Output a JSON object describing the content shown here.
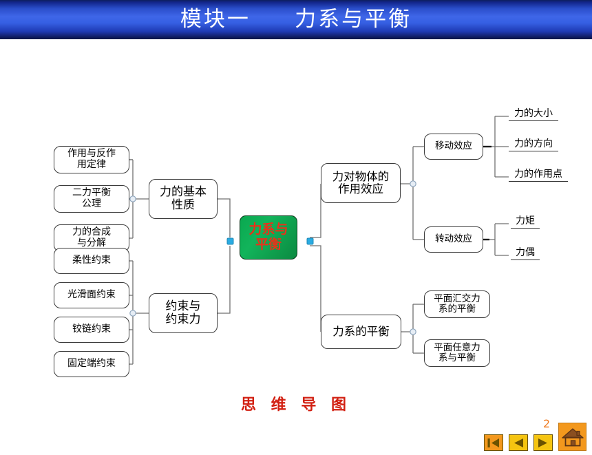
{
  "slide": {
    "title": "模块一     力系与平衡",
    "caption": "思 维 导 图",
    "page_number": "2",
    "colors": {
      "title_bar_blue": "#3f66e8",
      "title_text": "#ffffff",
      "root_green": "#0aa84f",
      "root_text_red": "#e8321a",
      "caption_red": "#d22012",
      "node_border": "#3b3b3b",
      "connector_dot_blue": "#29abe2",
      "connector_dot_gray": "#b8c4cf",
      "nav_orange": "#F3981D",
      "nav_yellow": "#F5C411",
      "page_number_orange": "#f07c22",
      "house_brown": "#8a4f20"
    }
  },
  "mindmap": {
    "root": {
      "label": "力系与\n平衡"
    },
    "branches": [
      {
        "id": "force-basic-properties",
        "label": "力的基本\n性质",
        "side": "left",
        "children": [
          {
            "id": "action-reaction-law",
            "label": "作用与反作\n用定律"
          },
          {
            "id": "two-force-balance-axiom",
            "label": "二力平衡\n公理"
          },
          {
            "id": "force-composition-decomposition",
            "label": "力的合成\n与分解"
          }
        ]
      },
      {
        "id": "constraint-and-constraint-force",
        "label": "约束与\n约束力",
        "side": "left",
        "children": [
          {
            "id": "flexible-constraint",
            "label": "柔性约束"
          },
          {
            "id": "smooth-surface-constraint",
            "label": "光滑面约束"
          },
          {
            "id": "hinge-constraint",
            "label": "铰链约束"
          },
          {
            "id": "fixed-end-constraint",
            "label": "固定端约束"
          }
        ]
      },
      {
        "id": "force-effect-on-object",
        "label": "力对物体的\n作用效应",
        "side": "right",
        "children": [
          {
            "id": "translation-effect",
            "label": "移动效应",
            "children": [
              {
                "id": "force-magnitude",
                "label": "力的大小"
              },
              {
                "id": "force-direction",
                "label": "力的方向"
              },
              {
                "id": "force-application-point",
                "label": "力的作用点"
              }
            ]
          },
          {
            "id": "rotation-effect",
            "label": "转动效应",
            "children": [
              {
                "id": "moment-of-force",
                "label": "力矩"
              },
              {
                "id": "couple",
                "label": "力偶"
              }
            ]
          }
        ]
      },
      {
        "id": "equilibrium-of-force-system",
        "label": "力系的平衡",
        "side": "right",
        "children": [
          {
            "id": "concurrent-planar-force-equilibrium",
            "label": "平面汇交力\n系的平衡"
          },
          {
            "id": "general-planar-force-equilibrium",
            "label": "平面任意力\n系与平衡"
          }
        ]
      }
    ]
  },
  "nav": {
    "first_label": "first-slide",
    "prev_label": "previous-slide",
    "next_label": "next-slide",
    "home_label": "home"
  }
}
